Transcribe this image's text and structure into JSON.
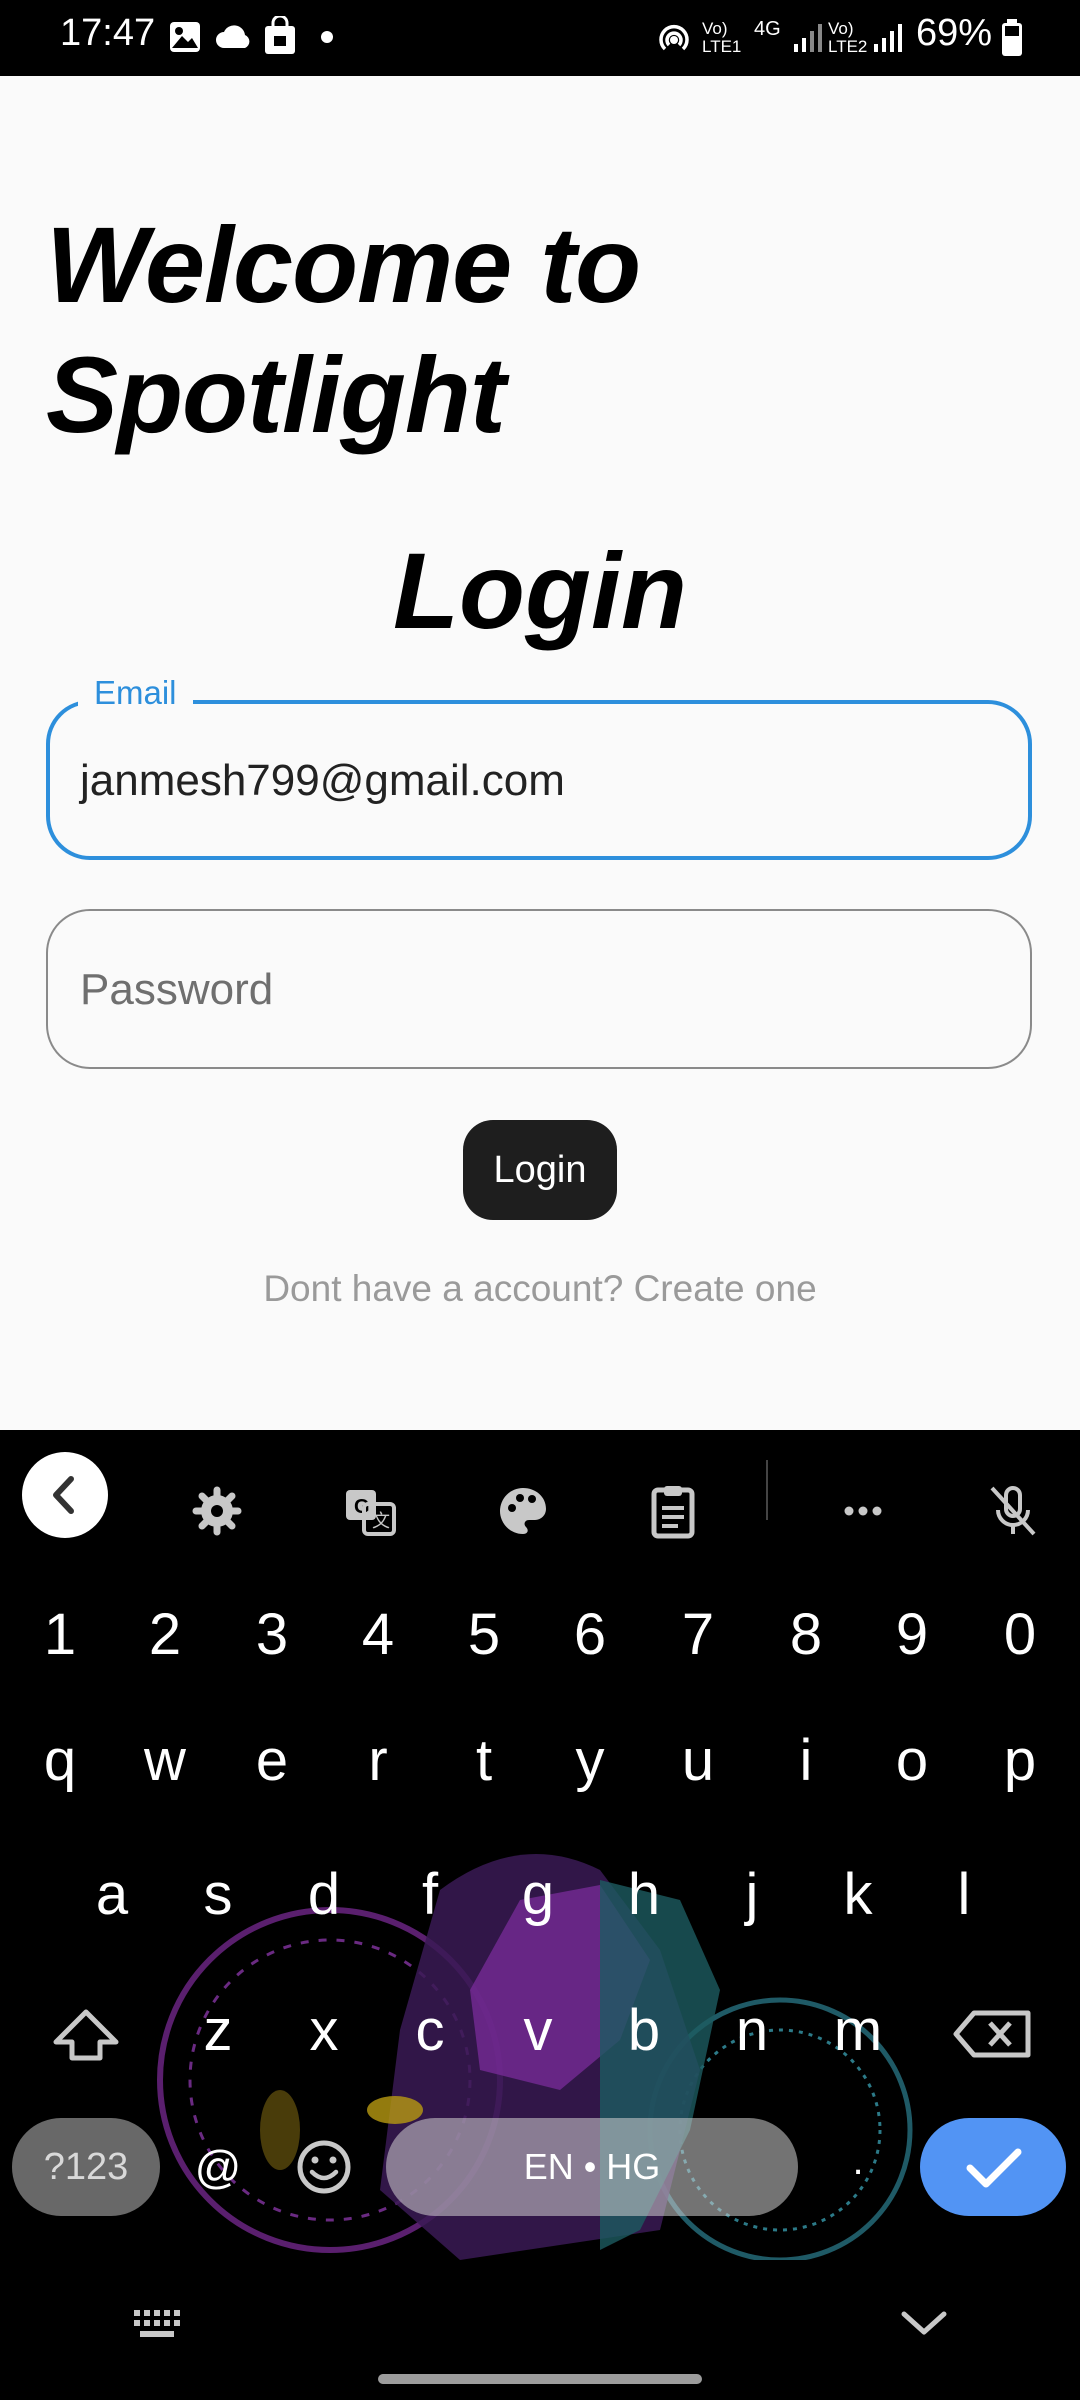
{
  "status_bar": {
    "time": "17:47",
    "battery": "69%",
    "net_1": "Vo) LTE1",
    "net_type": "4G",
    "net_2": "Vo) LTE2"
  },
  "app": {
    "welcome_title": "Welcome to\nSpotlight",
    "login_heading": "Login",
    "email": {
      "label": "Email",
      "value": "janmesh799@gmail.com",
      "focused": true,
      "accent_color": "#2d8fdc"
    },
    "password": {
      "placeholder": "Password",
      "value": ""
    },
    "login_button_label": "Login",
    "signup_text": "Dont have a account? Create one"
  },
  "keyboard": {
    "toolbar_icons": [
      "back-icon",
      "settings-icon",
      "translate-icon",
      "palette-icon",
      "clipboard-icon",
      "more-icon",
      "mic-off-icon"
    ],
    "rows": {
      "numbers": [
        "1",
        "2",
        "3",
        "4",
        "5",
        "6",
        "7",
        "8",
        "9",
        "0"
      ],
      "row1": [
        "q",
        "w",
        "e",
        "r",
        "t",
        "y",
        "u",
        "i",
        "o",
        "p"
      ],
      "row2": [
        "a",
        "s",
        "d",
        "f",
        "g",
        "h",
        "j",
        "k",
        "l"
      ],
      "row3": [
        "z",
        "x",
        "c",
        "v",
        "b",
        "n",
        "m"
      ]
    },
    "sym_label": "?123",
    "at_label": "@",
    "space_label": "EN • HG",
    "period_label": ".",
    "enter_color": "#5294f4"
  }
}
